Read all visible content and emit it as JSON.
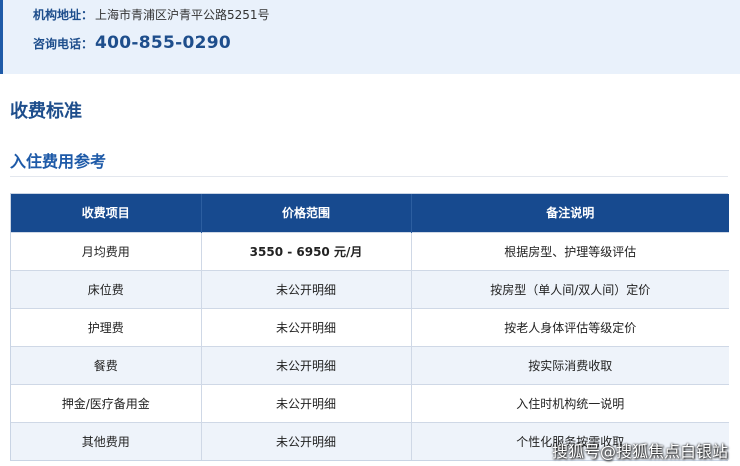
{
  "info": {
    "address_label": "机构地址：",
    "address_value": "上海市青浦区沪青平公路5251号",
    "phone_label": "咨询电话：",
    "phone_value": "400-855-0290"
  },
  "section_title": "收费标准",
  "subsection_title": "入住费用参考",
  "table": {
    "headers": [
      "收费项目",
      "价格范围",
      "备注说明"
    ],
    "rows": [
      [
        "月均费用",
        "3550 - 6950 元/月",
        "根据房型、护理等级评估"
      ],
      [
        "床位费",
        "未公开明细",
        "按房型（单人间/双人间）定价"
      ],
      [
        "护理费",
        "未公开明细",
        "按老人身体评估等级定价"
      ],
      [
        "餐费",
        "未公开明细",
        "按实际消费收取"
      ],
      [
        "押金/医疗备用金",
        "未公开明细",
        "入住时机构统一说明"
      ],
      [
        "其他费用",
        "未公开明细",
        "个性化服务按需收取"
      ]
    ]
  },
  "watermark": "搜狐号@搜狐焦点白银站"
}
